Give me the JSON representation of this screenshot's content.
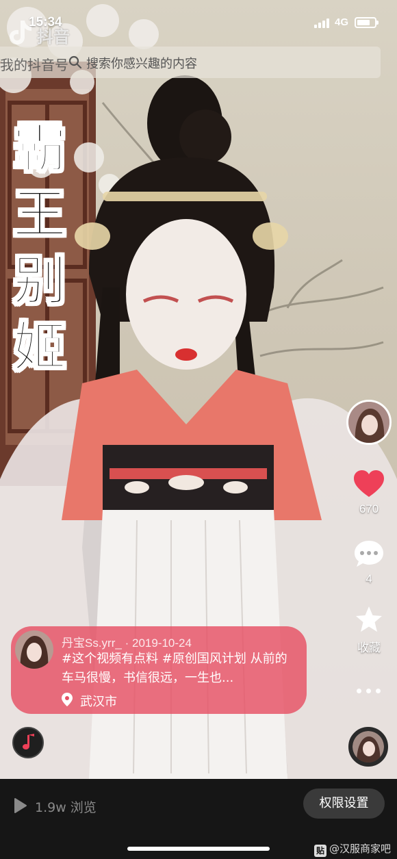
{
  "status_bar": {
    "time": "15:34",
    "network": "4G",
    "battery_level": 0.75
  },
  "app": {
    "logo_text": "抖音"
  },
  "search": {
    "back_text": "我的抖音号",
    "placeholder": "搜索你感兴趣的内容"
  },
  "video": {
    "title_chars": [
      "霸",
      "王",
      "别",
      "姬"
    ]
  },
  "actions": {
    "likes": "670",
    "comments": "4",
    "favorite_label": "收藏"
  },
  "post": {
    "author": "丹宝Ss.yrr_",
    "separator": "·",
    "date": "2019-10-24",
    "description": "#这个视频有点料 #原创国风计划 从前的车马很慢，书信很远，一生也...",
    "location": "武汉市"
  },
  "bottom": {
    "views": "1.9w 浏览",
    "permission_button": "权限设置"
  },
  "watermark": {
    "badge": "贴",
    "text": "@汉服商家吧"
  },
  "colors": {
    "like": "#ee4058",
    "card": "#e65064",
    "bottom_bg": "#161616"
  }
}
